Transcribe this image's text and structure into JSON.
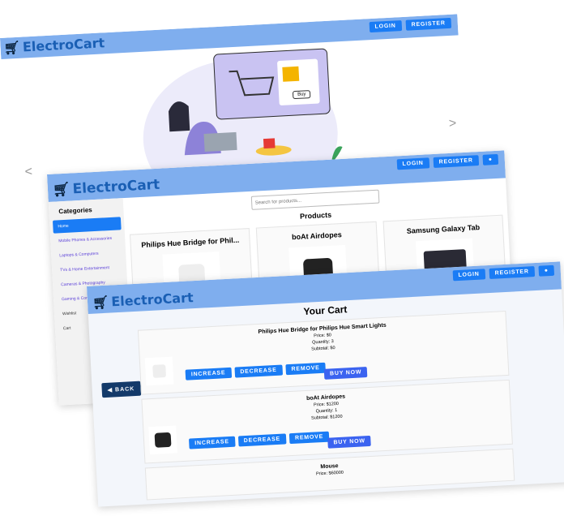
{
  "brand": "ElectroCart",
  "nav": {
    "login": "LOGIN",
    "register": "REGISTER",
    "user_icon": "user-icon"
  },
  "hero": {
    "prev": "<",
    "next": ">",
    "buy_label": "Buy"
  },
  "catalog": {
    "categories_title": "Categories",
    "categories": [
      "Home",
      "Mobile Phones & Accessories",
      "Laptops & Computers",
      "TVs & Home Entertainment",
      "Cameras & Photography",
      "Gaming & Consoles",
      "Wishlist",
      "Cart"
    ],
    "search_placeholder": "Search for products...",
    "products_title": "Products",
    "products": [
      "Philips Hue Bridge for Phil...",
      "boAt Airdopes",
      "Samsung Galaxy Tab"
    ]
  },
  "cart": {
    "title": "Your Cart",
    "back": "BACK",
    "increase": "INCREASE",
    "decrease": "DECREASE",
    "remove": "REMOVE",
    "buy_now": "BUY NOW",
    "items": [
      {
        "name": "Philips Hue Bridge for Philips Hue Smart Lights",
        "price": "Price: $0",
        "quantity": "Quantity: 3",
        "subtotal": "Subtotal: $0"
      },
      {
        "name": "boAt Airdopes",
        "price": "Price: $1200",
        "quantity": "Quantity: 1",
        "subtotal": "Subtotal: $1200"
      },
      {
        "name": "Mouse",
        "price": "Price: $60000"
      }
    ]
  }
}
